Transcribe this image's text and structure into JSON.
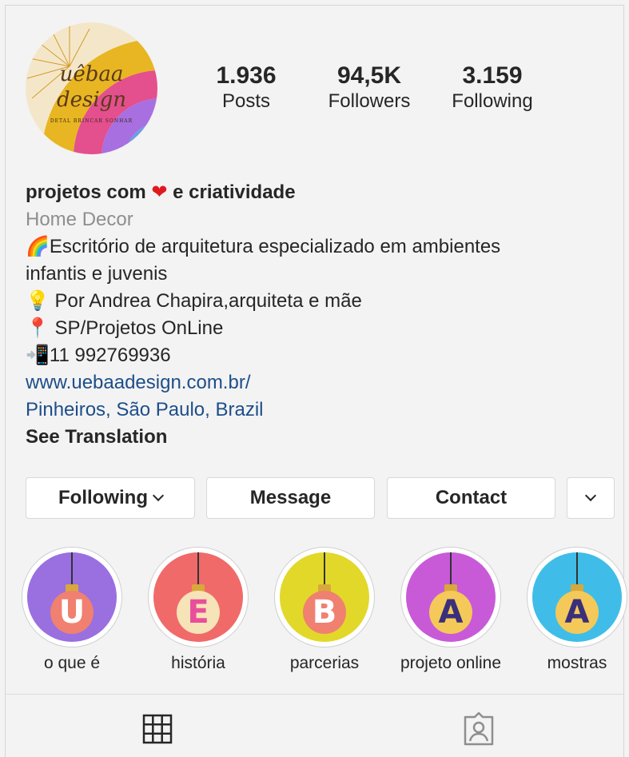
{
  "profile": {
    "logo_text_line1": "uêbaa",
    "logo_text_line2": "design",
    "logo_tagline": "DETAL BRINCAR SONHAR",
    "display_name": "projetos com",
    "display_name_heart": "❤",
    "display_name_suffix": "e criatividade",
    "category": "Home Decor",
    "bio_line1": "🌈Escritório de arquitetura especializado em ambientes",
    "bio_line2": "infantis e juvenis",
    "bio_line3": "💡 Por Andrea Chapira,arquiteta e mãe",
    "bio_line4": "📍 SP/Projetos OnLine",
    "bio_line5": "📲11 992769936",
    "website": "www.uebaadesign.com.br/",
    "location": "Pinheiros, São Paulo, Brazil",
    "see_translation": "See Translation"
  },
  "stats": {
    "posts_value": "1.936",
    "posts_label": "Posts",
    "followers_value": "94,5K",
    "followers_label": "Followers",
    "following_value": "3.159",
    "following_label": "Following"
  },
  "actions": {
    "following_label": "Following",
    "message_label": "Message",
    "contact_label": "Contact"
  },
  "highlights": [
    {
      "label": "o que é",
      "letter": "U",
      "bg": "#9a6fe0",
      "bulb": "#f08070",
      "letter_color": "#ffffff"
    },
    {
      "label": "história",
      "letter": "E",
      "bg": "#f06a6a",
      "bulb": "#f7e3b8",
      "letter_color": "#e84f9a"
    },
    {
      "label": "parcerias",
      "letter": "B",
      "bg": "#e2d82a",
      "bulb": "#f08070",
      "letter_color": "#ffffff"
    },
    {
      "label": "projeto online",
      "letter": "A",
      "bg": "#c85ad8",
      "bulb": "#f4c95a",
      "letter_color": "#3a2f7a"
    },
    {
      "label": "mostras",
      "letter": "A",
      "bg": "#3fbde8",
      "bulb": "#f4c95a",
      "letter_color": "#3a2f7a"
    }
  ],
  "icons": {
    "grid_tab": "grid-icon",
    "tagged_tab": "tagged-icon",
    "dropdown": "chevron-down-icon"
  }
}
